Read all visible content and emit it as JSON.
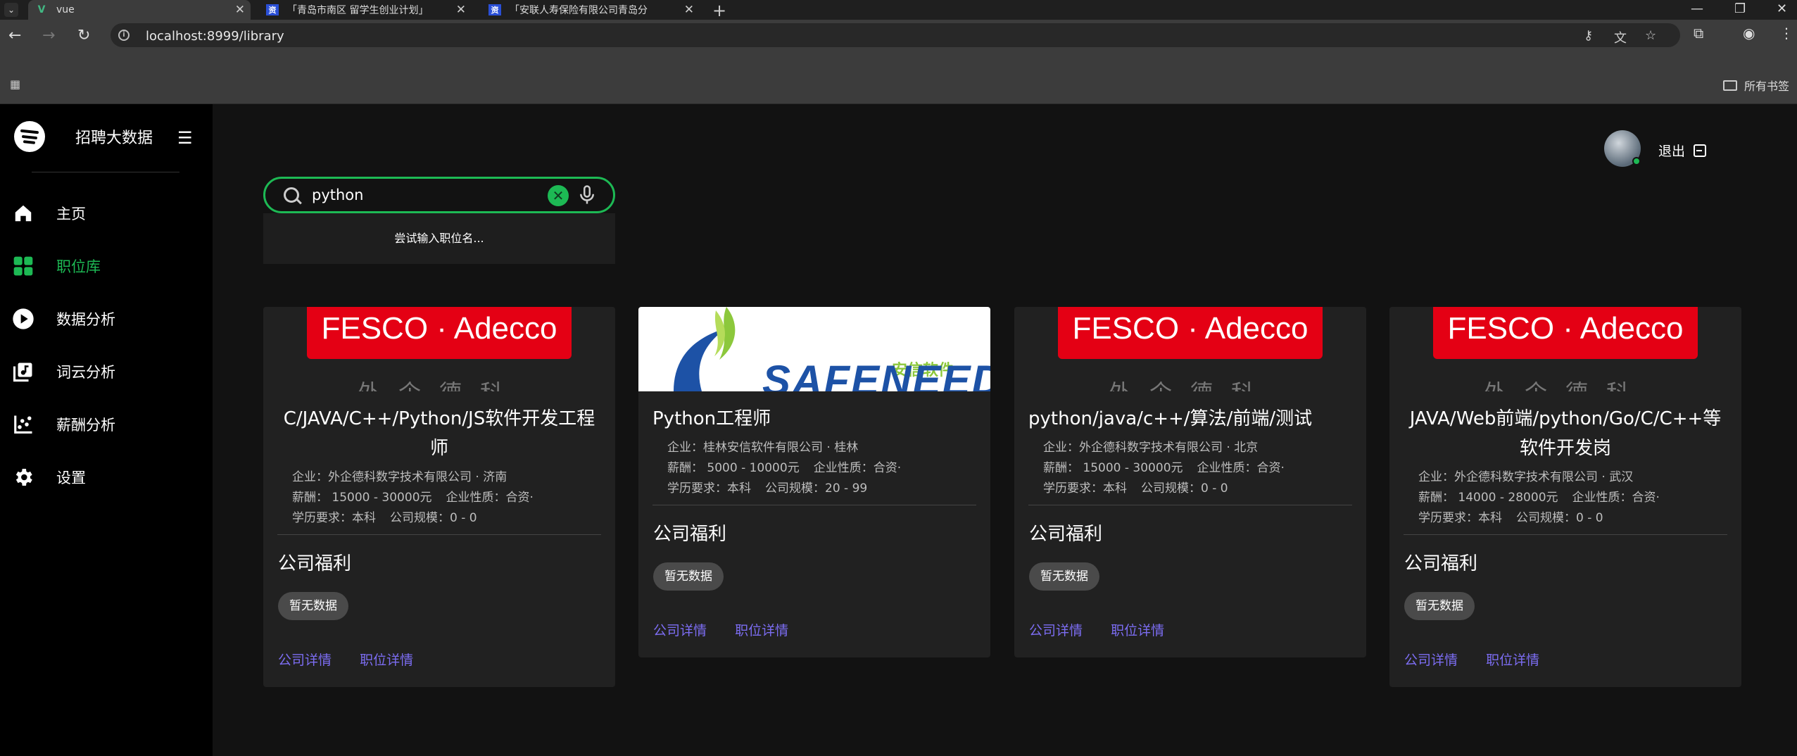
{
  "browser": {
    "tabs": [
      {
        "title": "vue",
        "favicon_color": "#42b883",
        "favicon": "V"
      },
      {
        "title": "「青岛市南区 留学生创业计划」",
        "favicon_color": "#2a4fd6",
        "favicon": "资"
      },
      {
        "title": "「安联人寿保险有限公司青岛分",
        "favicon_color": "#2a4fd6",
        "favicon": "资"
      }
    ],
    "url": "localhost:8999/library",
    "bookmarks_folder": "所有书签"
  },
  "app": {
    "brand_name": "招聘大数据",
    "nav": [
      {
        "label": "主页",
        "icon": "home-icon"
      },
      {
        "label": "职位库",
        "icon": "grid-icon",
        "active": true
      },
      {
        "label": "数据分析",
        "icon": "play-circle-icon"
      },
      {
        "label": "词云分析",
        "icon": "music-library-icon"
      },
      {
        "label": "薪酬分析",
        "icon": "scatter-chart-icon"
      },
      {
        "label": "设置",
        "icon": "gear-icon"
      }
    ],
    "logout_label": "退出",
    "search": {
      "value": "python",
      "suggestion": "尝试输入职位名..."
    },
    "accent": "#1db954",
    "link_color": "#7c6df2"
  },
  "labels": {
    "welfare": "公司福利",
    "company_detail": "公司详情",
    "job_detail": "职位详情",
    "no_data": "暂无数据"
  },
  "jobs": [
    {
      "logo": "FESCO · Adecco",
      "logo_sub": "外企德科",
      "title": "C/JAVA/C++/Python/JS软件开发工程师",
      "line1": "企业：外企德科数字技术有限公司 · 济南",
      "line2a": "薪酬： 15000 - 30000元",
      "line2b": "企业性质：合资·",
      "line3a": "学历要求：本科",
      "line3b": "公司规模：0 - 0"
    },
    {
      "logo": "SAFENEEDS",
      "logo_sub": "安信软件",
      "title": "Python工程师",
      "line1": "企业：桂林安信软件有限公司 · 桂林",
      "line2a": "薪酬： 5000 - 10000元",
      "line2b": "企业性质：合资·",
      "line3a": "学历要求：本科",
      "line3b": "公司规模：20 - 99"
    },
    {
      "logo": "FESCO · Adecco",
      "logo_sub": "外企德科",
      "title": "python/java/c++/算法/前端/测试",
      "line1": "企业：外企德科数字技术有限公司 · 北京",
      "line2a": "薪酬： 15000 - 30000元",
      "line2b": "企业性质：合资·",
      "line3a": "学历要求：本科",
      "line3b": "公司规模：0 - 0"
    },
    {
      "logo": "FESCO · Adecco",
      "logo_sub": "外企德科",
      "title": "JAVA/Web前端/python/Go/C/C++等软件开发岗",
      "line1": "企业：外企德科数字技术有限公司 · 武汉",
      "line2a": "薪酬： 14000 - 28000元",
      "line2b": "企业性质：合资·",
      "line3a": "学历要求：本科",
      "line3b": "公司规模：0 - 0"
    }
  ]
}
